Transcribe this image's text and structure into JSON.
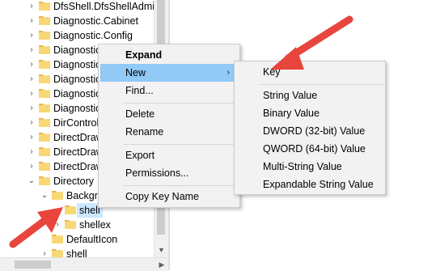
{
  "tree": {
    "rows": [
      {
        "label": "DfsShell.DfsShellAdmin",
        "expander": "›"
      },
      {
        "label": "Diagnostic.Cabinet",
        "expander": "›"
      },
      {
        "label": "Diagnostic.Config",
        "expander": "›"
      },
      {
        "label": "Diagnostic",
        "expander": "›"
      },
      {
        "label": "Diagnostic",
        "expander": "›"
      },
      {
        "label": "Diagnostic",
        "expander": "›"
      },
      {
        "label": "Diagnostic",
        "expander": "›"
      },
      {
        "label": "Diagnostic",
        "expander": "›"
      },
      {
        "label": "DirControl",
        "expander": "›"
      },
      {
        "label": "DirectDraw",
        "expander": "›"
      },
      {
        "label": "DirectDraw",
        "expander": "›"
      },
      {
        "label": "DirectDraw",
        "expander": "›"
      },
      {
        "label": "Directory",
        "expander": "⌄"
      },
      {
        "label": "Backgr",
        "expander": "⌄"
      },
      {
        "label": "shell",
        "expander": ""
      },
      {
        "label": "shellex",
        "expander": "›"
      },
      {
        "label": "DefaultIcon",
        "expander": ""
      },
      {
        "label": "shell",
        "expander": "›"
      }
    ]
  },
  "context_menu": {
    "items": [
      {
        "label": "Expand",
        "bold": true
      },
      {
        "label": "New",
        "submenu_arrow": "›"
      },
      {
        "label": "Find..."
      },
      {
        "label": "Delete"
      },
      {
        "label": "Rename"
      },
      {
        "label": "Export"
      },
      {
        "label": "Permissions..."
      },
      {
        "label": "Copy Key Name"
      }
    ]
  },
  "submenu": {
    "items": [
      {
        "label": "Key"
      },
      {
        "label": "String Value"
      },
      {
        "label": "Binary Value"
      },
      {
        "label": "DWORD (32-bit) Value"
      },
      {
        "label": "QWORD (64-bit) Value"
      },
      {
        "label": "Multi-String Value"
      },
      {
        "label": "Expandable String Value"
      }
    ]
  },
  "scrollbar": {
    "down_arrow": "▼",
    "right_arrow": "▶"
  },
  "colors": {
    "folder": "#f8d775",
    "folder_dark": "#e8b84a",
    "highlight": "#91c9f7",
    "selection": "#cce8ff",
    "annotation_arrow": "#e8453c"
  },
  "icons": {
    "folder": "folder-icon",
    "annotation": "red-arrow-icon"
  }
}
